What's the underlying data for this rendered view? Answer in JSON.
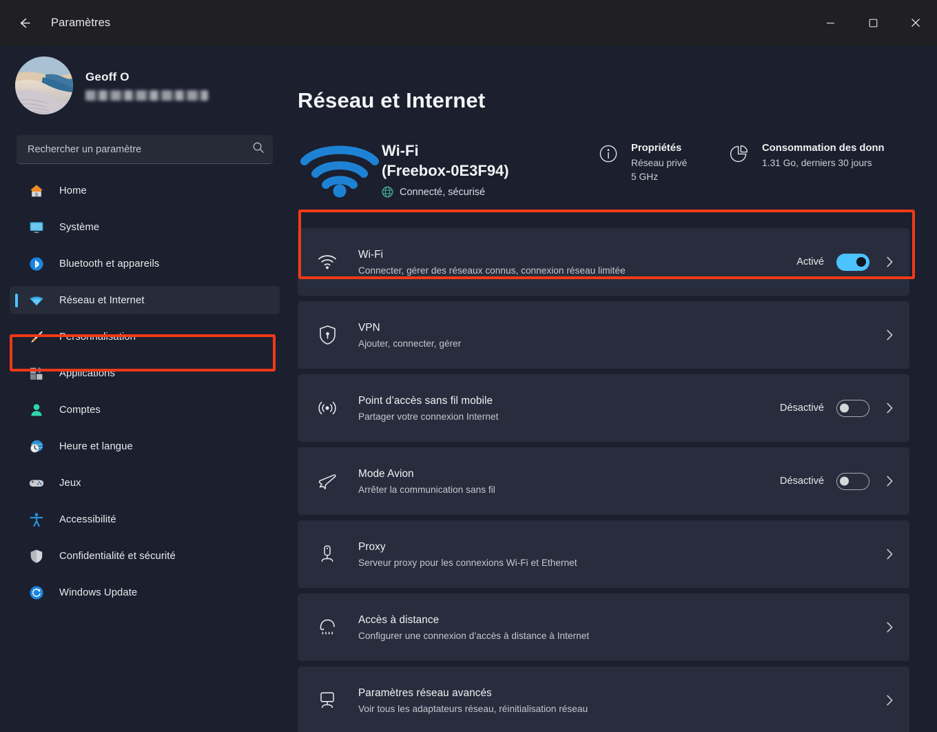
{
  "titlebar": {
    "back_label": "back-arrow",
    "title": "Paramètres",
    "minimize": "—",
    "maximize": "▢",
    "close": "✕"
  },
  "sidebar": {
    "profile": {
      "name": "Geoff O",
      "email_redacted": ""
    },
    "search": {
      "placeholder": "Rechercher un paramètre",
      "value": ""
    },
    "items": [
      {
        "label": "Home",
        "icon": "home-icon",
        "selected": false
      },
      {
        "label": "Système",
        "icon": "system-icon",
        "selected": false
      },
      {
        "label": "Bluetooth et appareils",
        "icon": "bluetooth-icon",
        "selected": false
      },
      {
        "label": "Réseau et Internet",
        "icon": "network-icon",
        "selected": true
      },
      {
        "label": "Personnalisation",
        "icon": "brush-icon",
        "selected": false
      },
      {
        "label": "Applications",
        "icon": "apps-icon",
        "selected": false
      },
      {
        "label": "Comptes",
        "icon": "account-icon",
        "selected": false
      },
      {
        "label": "Heure et langue",
        "icon": "clock-globe-icon",
        "selected": false
      },
      {
        "label": "Jeux",
        "icon": "gamepad-icon",
        "selected": false
      },
      {
        "label": "Accessibilité",
        "icon": "accessibility-icon",
        "selected": false
      },
      {
        "label": "Confidentialité et sécurité",
        "icon": "shield-icon",
        "selected": false
      },
      {
        "label": "Windows Update",
        "icon": "update-icon",
        "selected": false
      }
    ]
  },
  "main": {
    "page_title": "Réseau et Internet",
    "hero": {
      "wifi_icon": "wifi-large-icon",
      "title_line1": "Wi-Fi",
      "title_line2": "(Freebox-0E3F94)",
      "status_icon": "globe-icon",
      "status": "Connecté, sécurisé",
      "properties": {
        "icon": "info-circle-icon",
        "title": "Propriétés",
        "line1": "Réseau privé",
        "line2": "5 GHz"
      },
      "data_usage": {
        "icon": "pie-chart-icon",
        "title": "Consommation des donn",
        "line1": "1.31 Go, derniers 30 jours"
      }
    },
    "rows": [
      {
        "icon": "wifi-icon",
        "title": "Wi-Fi",
        "desc": "Connecter, gérer des réseaux connus, connexion réseau limitée",
        "toggle_label": "Activé",
        "toggle_state": "on",
        "has_toggle": true,
        "highlighted": true
      },
      {
        "icon": "vpn-shield-icon",
        "title": "VPN",
        "desc": "Ajouter, connecter, gérer",
        "toggle_label": "",
        "toggle_state": "",
        "has_toggle": false,
        "highlighted": false
      },
      {
        "icon": "hotspot-icon",
        "title": "Point d’accès sans fil mobile",
        "desc": "Partager votre connexion Internet",
        "toggle_label": "Désactivé",
        "toggle_state": "off",
        "has_toggle": true,
        "highlighted": false
      },
      {
        "icon": "airplane-icon",
        "title": "Mode Avion",
        "desc": "Arrêter la communication sans fil",
        "toggle_label": "Désactivé",
        "toggle_state": "off",
        "has_toggle": true,
        "highlighted": false
      },
      {
        "icon": "proxy-icon",
        "title": "Proxy",
        "desc": "Serveur proxy pour les connexions Wi-Fi et Ethernet",
        "toggle_label": "",
        "toggle_state": "",
        "has_toggle": false,
        "highlighted": false
      },
      {
        "icon": "dialup-icon",
        "title": "Accès à distance",
        "desc": "Configurer une connexion d’accès à distance à Internet",
        "toggle_label": "",
        "toggle_state": "",
        "has_toggle": false,
        "highlighted": false
      },
      {
        "icon": "advanced-network-icon",
        "title": "Paramètres réseau avancés",
        "desc": "Voir tous les adaptateurs réseau, réinitialisation réseau",
        "toggle_label": "",
        "toggle_state": "",
        "has_toggle": false,
        "highlighted": false
      }
    ]
  },
  "colors": {
    "accent": "#4cc2ff",
    "annotation": "#f03a17",
    "card": "#282d3d",
    "background": "#1b1f2e",
    "titlebar": "#202024"
  }
}
